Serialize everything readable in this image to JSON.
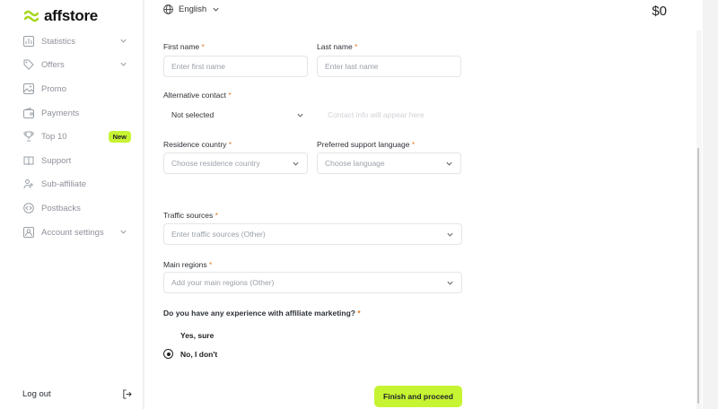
{
  "brand": {
    "name": "affstore",
    "accent": "#c6f432"
  },
  "sidebar": {
    "items": [
      {
        "label": "Statistics",
        "icon": "chart-icon",
        "has_chevron": true
      },
      {
        "label": "Offers",
        "icon": "tag-icon",
        "has_chevron": true
      },
      {
        "label": "Promo",
        "icon": "image-icon",
        "has_chevron": false
      },
      {
        "label": "Payments",
        "icon": "wallet-icon",
        "has_chevron": false
      },
      {
        "label": "Top 10",
        "icon": "trophy-icon",
        "has_chevron": false,
        "badge": "New"
      },
      {
        "label": "Support",
        "icon": "book-icon",
        "has_chevron": false
      },
      {
        "label": "Sub-affiliate",
        "icon": "users-icon",
        "has_chevron": false
      },
      {
        "label": "Postbacks",
        "icon": "code-icon",
        "has_chevron": false
      },
      {
        "label": "Account settings",
        "icon": "account-icon",
        "has_chevron": true
      }
    ],
    "logout": "Log out"
  },
  "topbar": {
    "language": "English",
    "balance": "$0"
  },
  "form": {
    "first_name": {
      "label": "First name",
      "required": "*",
      "placeholder": "Enter first name"
    },
    "last_name": {
      "label": "Last name",
      "required": "*",
      "placeholder": "Enter last name"
    },
    "alt_contact": {
      "label": "Alternative contact",
      "required": "*",
      "value": "Not selected",
      "hint": "Contact info will appear here"
    },
    "residence_country": {
      "label": "Residence country",
      "required": "*",
      "placeholder": "Choose residence country"
    },
    "support_language": {
      "label": "Preferred support language",
      "required": "*",
      "placeholder": "Choose language"
    },
    "traffic_sources": {
      "label": "Traffic sources",
      "required": "*",
      "placeholder": "Enter traffic sources (Other)"
    },
    "main_regions": {
      "label": "Main regions",
      "required": "*",
      "placeholder": "Add your main regions (Other)"
    },
    "experience": {
      "question": "Do you have any experience with affiliate marketing?",
      "required": "*",
      "options": [
        {
          "label": "Yes, sure",
          "selected": false
        },
        {
          "label": "No, I don't",
          "selected": true
        }
      ]
    },
    "submit": "Finish and proceed"
  }
}
